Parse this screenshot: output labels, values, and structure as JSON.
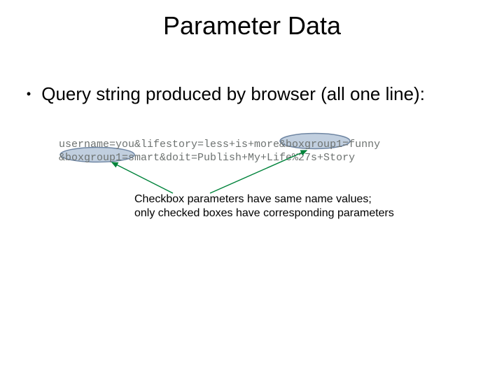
{
  "title": "Parameter Data",
  "bullet": "Query string produced by browser (all one line):",
  "code": {
    "line1": "username=you&lifestory=less+is+more&boxgroup1=funny",
    "line2": "&boxgroup1=smart&doit=Publish+My+Life%27s+Story"
  },
  "caption": {
    "line1": "Checkbox parameters have same name values;",
    "line2": "only checked boxes have corresponding parameters"
  },
  "annotations": {
    "ellipse_color": "#6f86a3",
    "ellipse_fill": "#c1cfdf",
    "arrow_color": "#00833b"
  }
}
